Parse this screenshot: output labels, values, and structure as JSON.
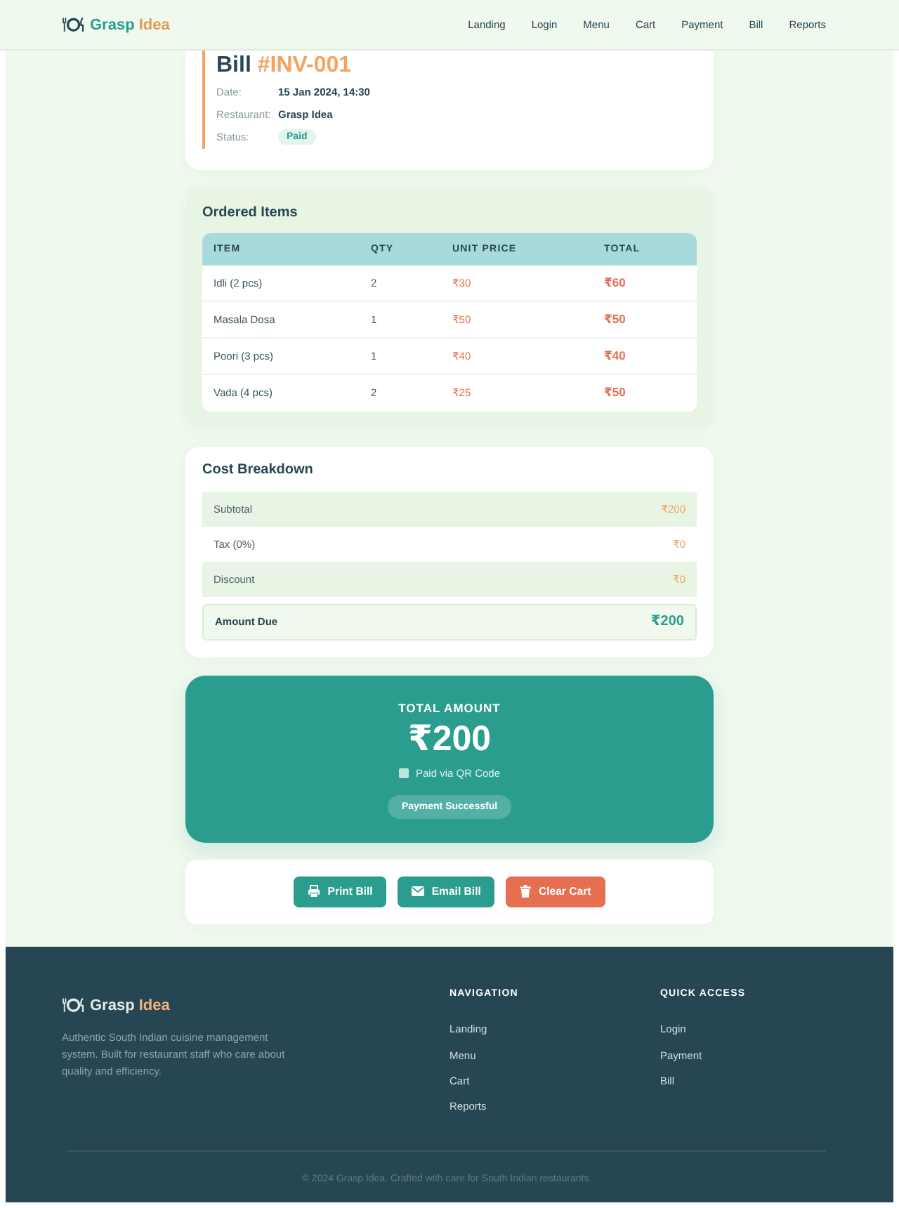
{
  "header": {
    "logo_words": [
      "Grasp",
      "Idea"
    ],
    "nav": [
      "Landing",
      "Login",
      "Menu",
      "Cart",
      "Payment",
      "Bill",
      "Reports"
    ]
  },
  "bill": {
    "title": "Bill",
    "number": "#INV-001",
    "fields": [
      {
        "label": "Date:",
        "value": "15 Jan 2024, 14:30",
        "kind": "text"
      },
      {
        "label": "Restaurant:",
        "value": "Grasp Idea",
        "kind": "text"
      },
      {
        "label": "Status:",
        "value": "Paid",
        "kind": "badge"
      }
    ]
  },
  "ordered_items": {
    "title": "Ordered Items",
    "columns": [
      "ITEM",
      "QTY",
      "UNIT PRICE",
      "TOTAL"
    ],
    "rows": [
      [
        "Idli (2 pcs)",
        "2",
        "₹30",
        "₹60"
      ],
      [
        "Masala Dosa",
        "1",
        "₹50",
        "₹50"
      ],
      [
        "Poori (3 pcs)",
        "1",
        "₹40",
        "₹40"
      ],
      [
        "Vada (4 pcs)",
        "2",
        "₹25",
        "₹50"
      ]
    ]
  },
  "cost_breakdown": {
    "title": "Cost Breakdown",
    "rows": [
      {
        "label": "Subtotal",
        "value": "₹200",
        "kind": "line"
      },
      {
        "label": "Tax (0%)",
        "value": "₹0",
        "kind": "line"
      },
      {
        "label": "Discount",
        "value": "₹0",
        "kind": "line"
      },
      {
        "label": "Amount Due",
        "value": "₹200",
        "kind": "total"
      }
    ]
  },
  "total": {
    "heading": "TOTAL AMOUNT",
    "amount": "₹200",
    "method": "Paid via QR Code",
    "status": "Payment Successful"
  },
  "actions": [
    {
      "label": "Print Bill",
      "kind": "print"
    },
    {
      "label": "Email Bill",
      "kind": "email"
    },
    {
      "label": "Clear Cart",
      "kind": "clear"
    }
  ],
  "footer": {
    "logo_words": [
      "Grasp",
      "Idea"
    ],
    "description": "Authentic South Indian cuisine management system. Built for restaurant staff who care about quality and efficiency.",
    "columns": [
      {
        "heading": "NAVIGATION",
        "links": [
          "Landing",
          "Menu",
          "Cart",
          "Reports"
        ]
      },
      {
        "heading": "QUICK ACCESS",
        "links": [
          "Login",
          "Payment",
          "Bill"
        ]
      }
    ],
    "copyright": "© 2024 Grasp Idea. Crafted with care for South Indian restaurants."
  }
}
